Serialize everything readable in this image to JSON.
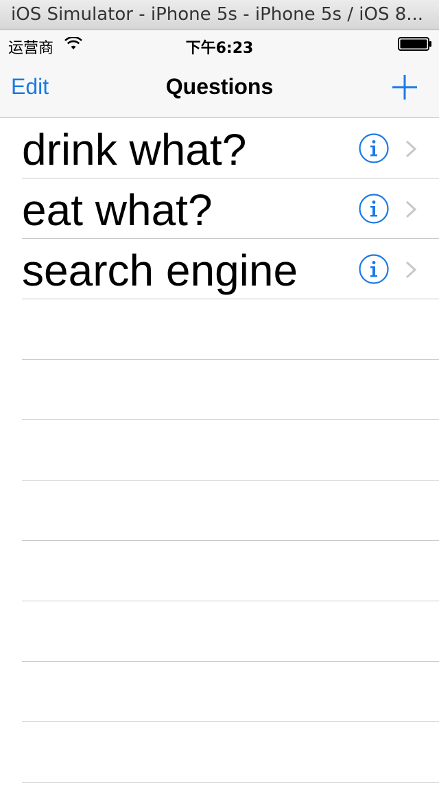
{
  "window": {
    "title": "iOS Simulator - iPhone 5s - iPhone 5s / iOS 8..."
  },
  "statusbar": {
    "carrier": "运营商",
    "time": "下午6:23",
    "icons": [
      "wifi-icon",
      "battery-icon"
    ]
  },
  "navbar": {
    "edit_label": "Edit",
    "title": "Questions",
    "add_icon": "plus-icon"
  },
  "colors": {
    "accent": "#1a7ae6",
    "separator": "#c8c7cc",
    "chevron": "#c7c7cc"
  },
  "table": {
    "rows": [
      {
        "label": "drink what?"
      },
      {
        "label": "eat what?"
      },
      {
        "label": "search engine"
      }
    ],
    "empty_rows": 8
  }
}
